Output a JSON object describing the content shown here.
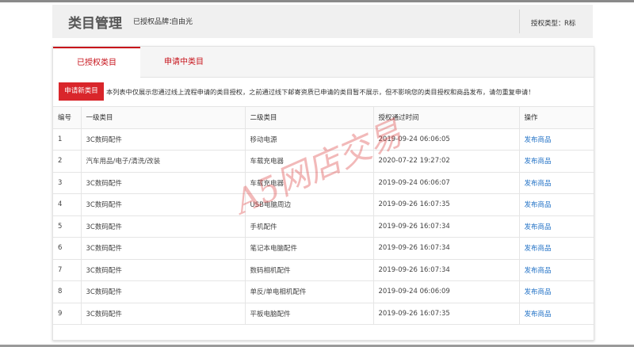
{
  "header": {
    "title": "类目管理",
    "brand_label": "已授权品牌：",
    "brand_value": "自由光",
    "auth_type_label": "授权类型：",
    "auth_type_value": "R标"
  },
  "tabs": [
    {
      "label": "已授权类目",
      "active": true
    },
    {
      "label": "申请中类目",
      "active": false
    }
  ],
  "apply_button": "申请新类目",
  "notice": "本列表中仅展示您通过线上流程申请的类目授权，之前通过线下邮寄资质已申请的类目暂不展示，但不影响您的类目授权和商品发布，请勿重复申请！",
  "table": {
    "columns": [
      "编号",
      "一级类目",
      "二级类目",
      "授权通过时间",
      "操作"
    ],
    "rows": [
      {
        "id": "1",
        "cat1": "3C数码配件",
        "cat2": "移动电源",
        "time": "2019-09-24 06:06:05",
        "action": "发布商品"
      },
      {
        "id": "2",
        "cat1": "汽车用品/电子/清洗/改装",
        "cat2": "车载充电器",
        "time": "2020-07-22 19:27:02",
        "action": "发布商品"
      },
      {
        "id": "3",
        "cat1": "3C数码配件",
        "cat2": "车载充电器",
        "time": "2019-09-24 06:06:07",
        "action": "发布商品"
      },
      {
        "id": "4",
        "cat1": "3C数码配件",
        "cat2": "USB电脑周边",
        "time": "2019-09-26 16:07:35",
        "action": "发布商品"
      },
      {
        "id": "5",
        "cat1": "3C数码配件",
        "cat2": "手机配件",
        "time": "2019-09-26 16:07:34",
        "action": "发布商品"
      },
      {
        "id": "6",
        "cat1": "3C数码配件",
        "cat2": "笔记本电脑配件",
        "time": "2019-09-26 16:07:34",
        "action": "发布商品"
      },
      {
        "id": "7",
        "cat1": "3C数码配件",
        "cat2": "数码相机配件",
        "time": "2019-09-26 16:07:34",
        "action": "发布商品"
      },
      {
        "id": "8",
        "cat1": "3C数码配件",
        "cat2": "单反/单电相机配件",
        "time": "2019-09-24 06:06:09",
        "action": "发布商品"
      },
      {
        "id": "9",
        "cat1": "3C数码配件",
        "cat2": "平板电脑配件",
        "time": "2019-09-26 16:07:35",
        "action": "发布商品"
      }
    ]
  },
  "watermark": "A5网店交易",
  "colors": {
    "accent": "#c7131b",
    "button": "#d9262b",
    "link": "#1e6fc5"
  }
}
